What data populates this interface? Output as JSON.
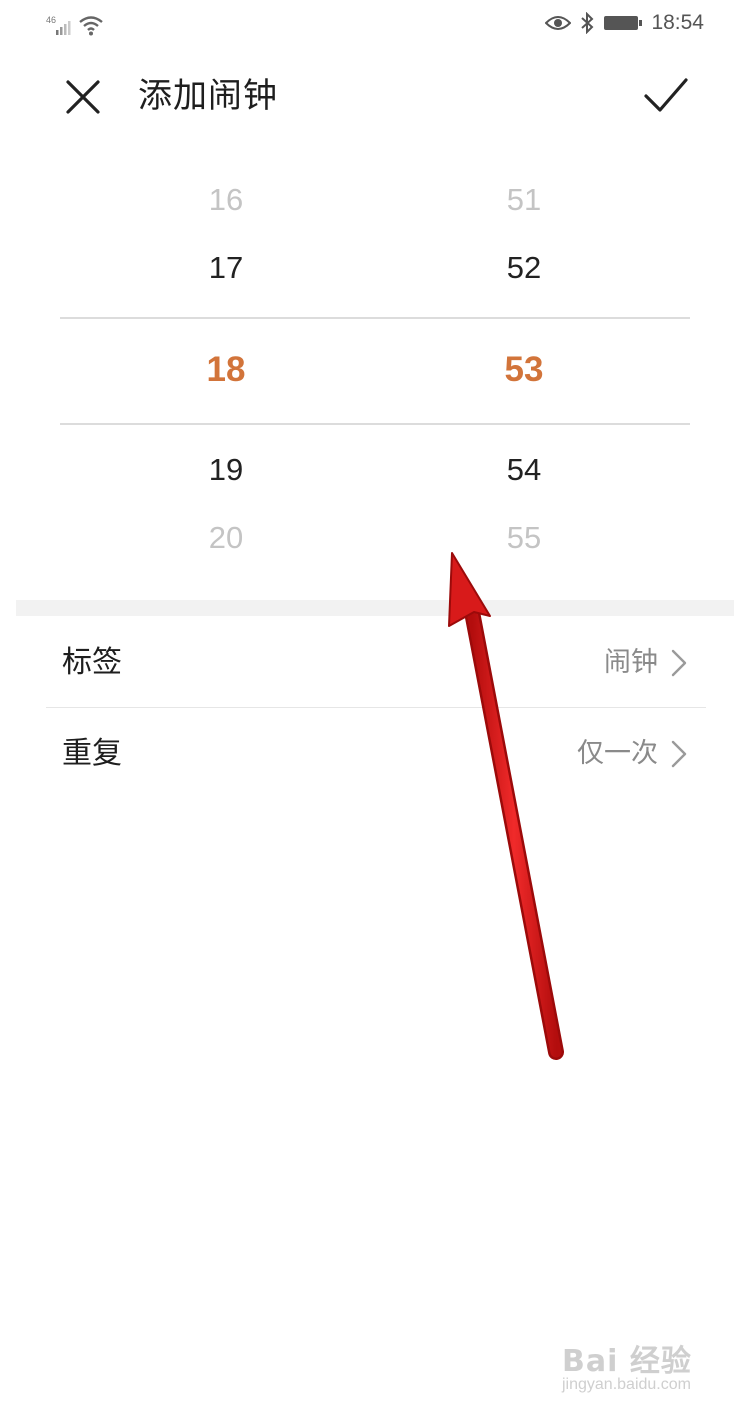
{
  "status_bar": {
    "time": "18:54",
    "icons": [
      "signal-icon",
      "wifi-icon",
      "eye-icon",
      "bluetooth-icon",
      "battery-icon"
    ]
  },
  "header": {
    "title": "添加闹钟",
    "close_icon": "close-icon",
    "confirm_icon": "check-icon"
  },
  "picker": {
    "hours": [
      "16",
      "17",
      "18",
      "19",
      "20"
    ],
    "minutes": [
      "51",
      "52",
      "53",
      "54",
      "55"
    ],
    "selected_hour": "18",
    "selected_minute": "53"
  },
  "settings": [
    {
      "label": "标签",
      "value": "闹钟"
    },
    {
      "label": "重复",
      "value": "仅一次"
    }
  ],
  "colors": {
    "accent": "#d2743a",
    "arrow": "#e01818"
  },
  "watermark": {
    "logo": "Bai 经验",
    "url": "jingyan.baidu.com"
  }
}
